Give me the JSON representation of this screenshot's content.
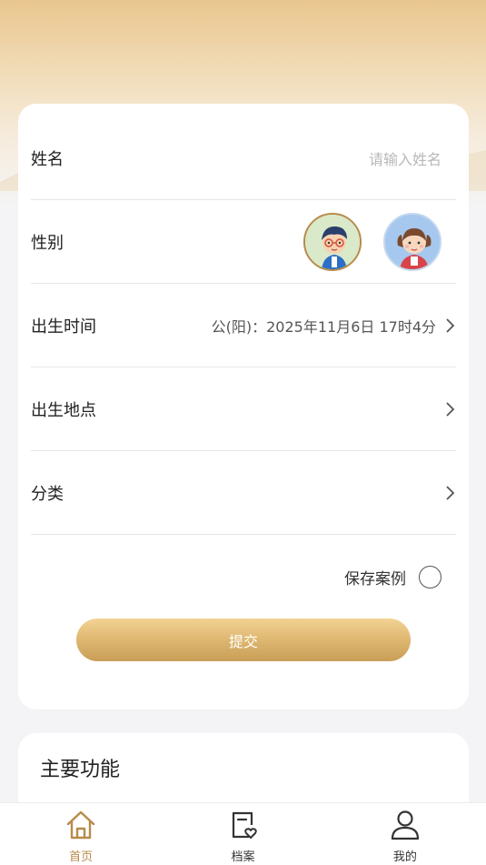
{
  "form": {
    "name_label": "姓名",
    "name_placeholder": "请输入姓名",
    "gender_label": "性别",
    "gender_options": [
      "boy",
      "girl"
    ],
    "gender_selected": "boy",
    "birth_time_label": "出生时间",
    "birth_time_value": "公(阳)：2025年11月6日 17时4分",
    "birth_place_label": "出生地点",
    "birth_place_value": "",
    "category_label": "分类",
    "category_value": "",
    "save_case_label": "保存案例",
    "save_case_checked": false,
    "submit_label": "提交"
  },
  "functions": {
    "title": "主要功能"
  },
  "tabbar": {
    "tabs": [
      {
        "label": "首页",
        "icon": "home-icon",
        "active": true
      },
      {
        "label": "档案",
        "icon": "archive-heart-icon",
        "active": false
      },
      {
        "label": "我的",
        "icon": "user-icon",
        "active": false
      }
    ]
  },
  "colors": {
    "accent": "#b88a4a",
    "button_gradient_top": "#f3d393",
    "button_gradient_bottom": "#c99f57",
    "background": "#f4f4f6"
  }
}
